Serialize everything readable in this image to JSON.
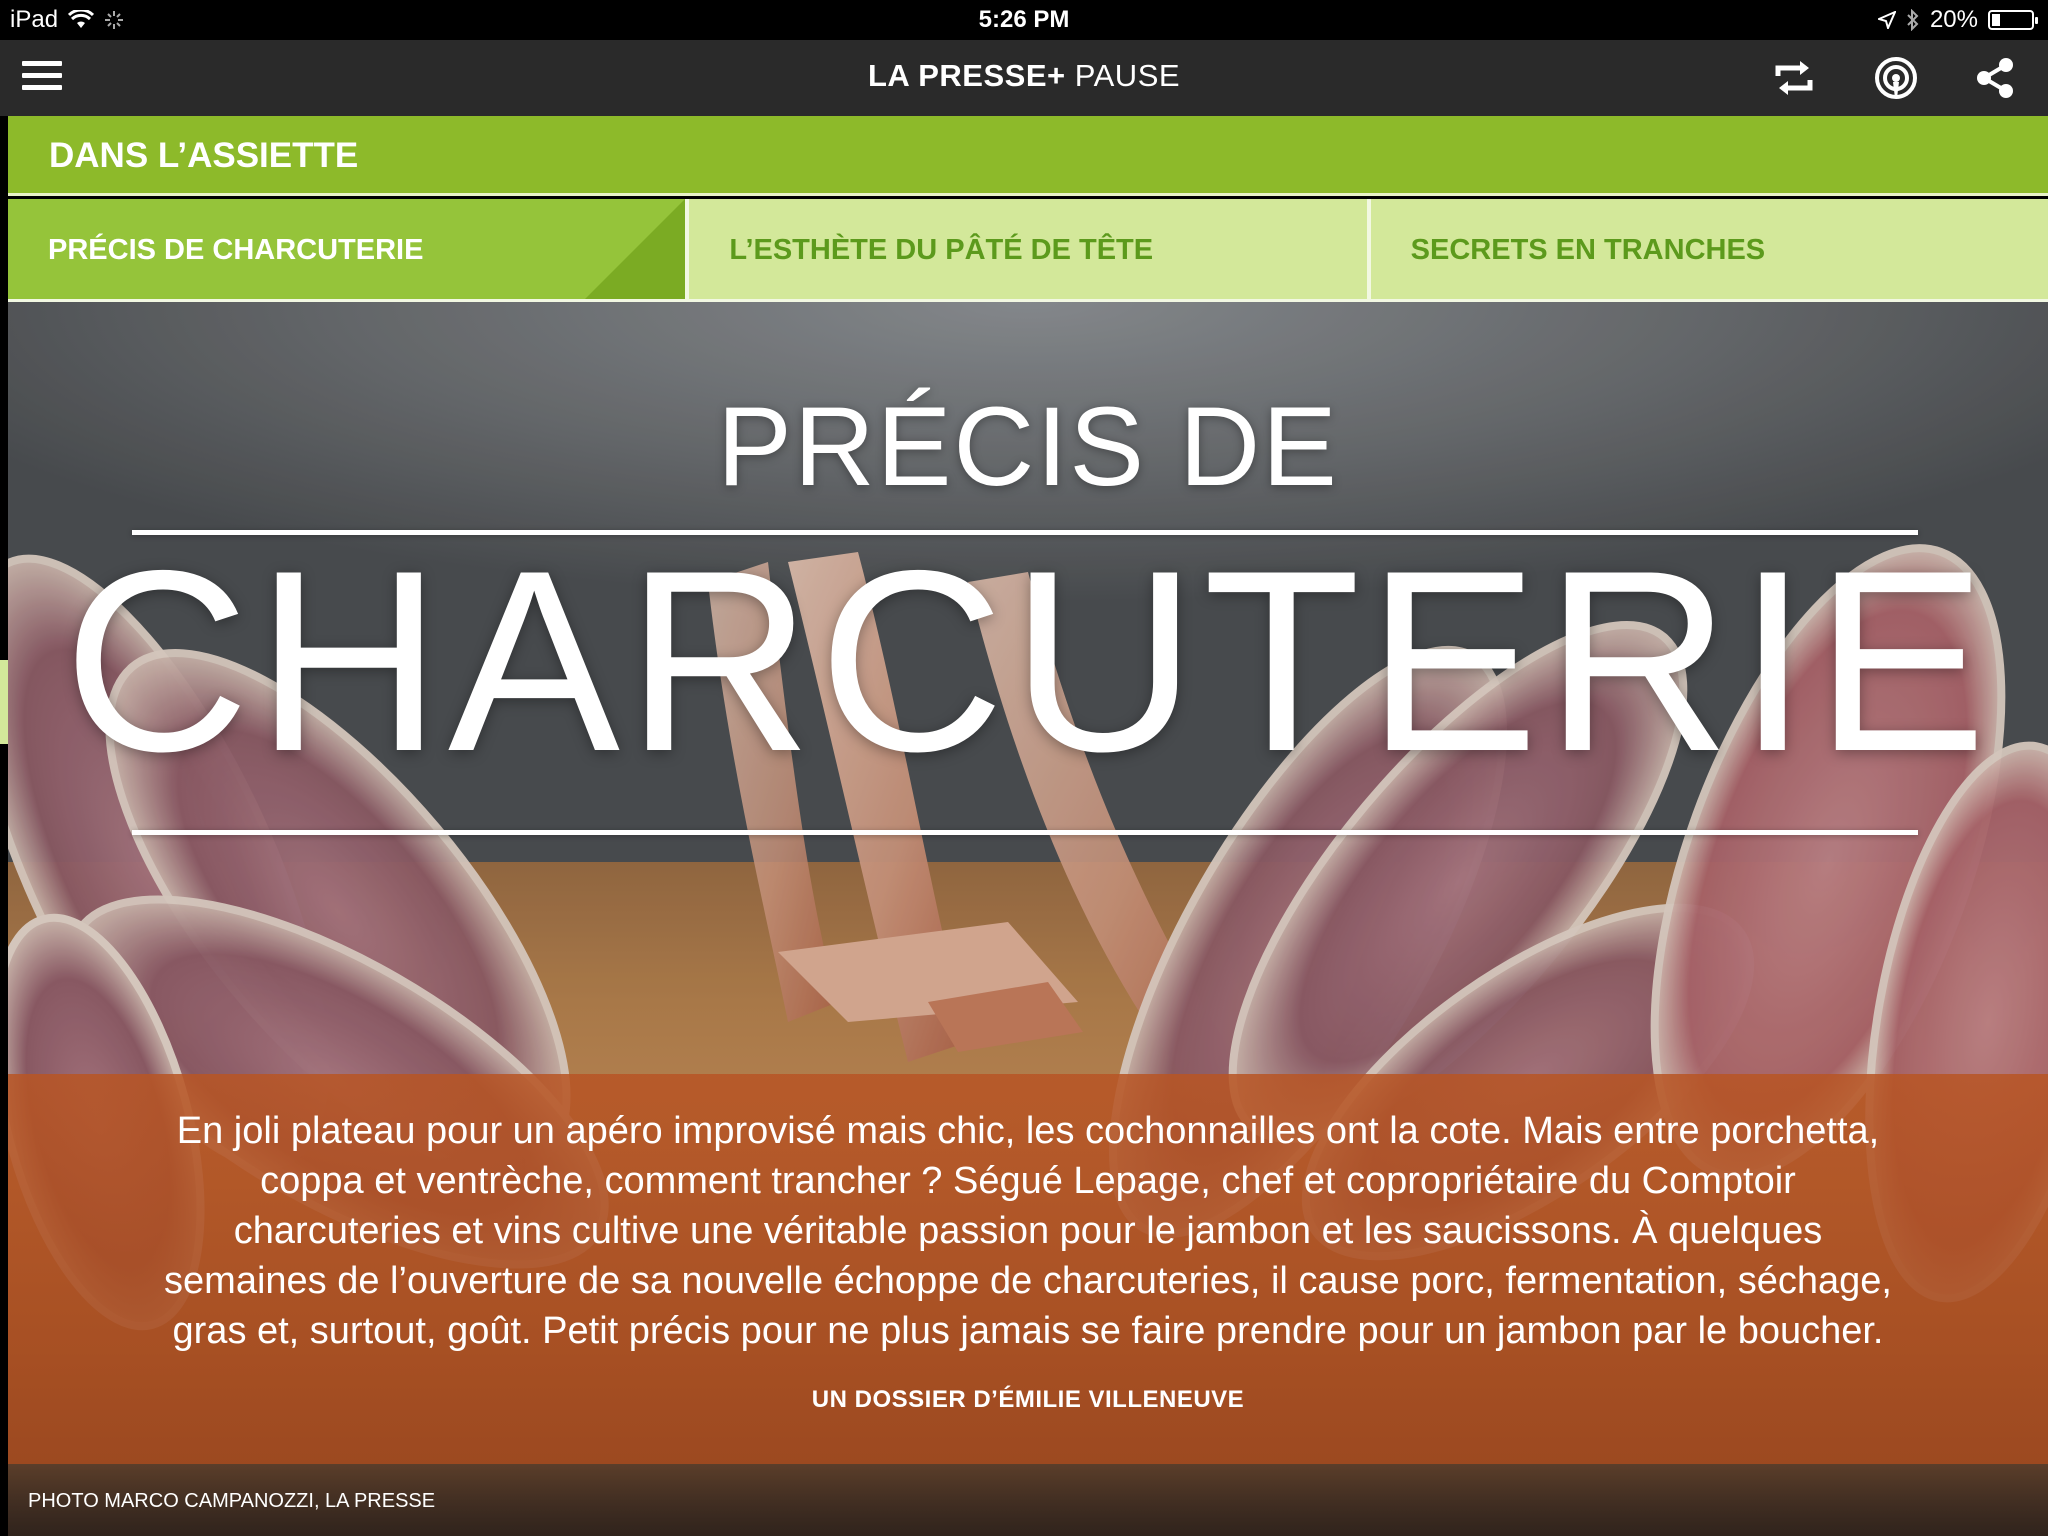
{
  "status_bar": {
    "device": "iPad",
    "time": "5:26 PM",
    "battery_pct_text": "20%",
    "battery_level": 0.2
  },
  "app_bar": {
    "brand_bold": "LA PRESSE+",
    "brand_light": "PAUSE",
    "icons": [
      "menu-icon",
      "refresh-icon",
      "podcast-icon",
      "share-icon"
    ]
  },
  "section": {
    "title": "DANS L’ASSIETTE"
  },
  "tabs": [
    {
      "label": "PRÉCIS DE CHARCUTERIE",
      "active": true
    },
    {
      "label": "L’ESTHÈTE DU PÂTÉ DE TÊTE",
      "active": false
    },
    {
      "label": "SECRETS EN TRANCHES",
      "active": false
    }
  ],
  "hero": {
    "title_small": "PRÉCIS DE",
    "title_big": "CHARCUTERIE",
    "intro": "En joli plateau pour un apéro improvisé mais chic, les cochonnailles ont la cote. Mais entre porchetta, coppa et ventrèche, comment trancher ? Ségué Lepage, chef et copropriétaire du Comptoir charcuteries et vins cultive une véritable passion pour le jambon et les saucissons. À quelques semaines de l’ouverture de sa nouvelle échoppe de charcuteries, il cause porc, fermentation, séchage, gras et, surtout, goût. Petit précis pour ne plus jamais se faire prendre pour un jambon par le boucher.",
    "byline": "UN DOSSIER D’ÉMILIE VILLENEUVE",
    "photo_credit": "PHOTO MARCO CAMPANOZZI, LA PRESSE"
  },
  "colors": {
    "green_header": "#8dba2a",
    "tab_active": "#95c43a",
    "tab_inactive": "#d3e89a",
    "tab_text": "#5c9a1c",
    "appbar": "#2a2a2a",
    "intro_panel": "#b85524"
  }
}
